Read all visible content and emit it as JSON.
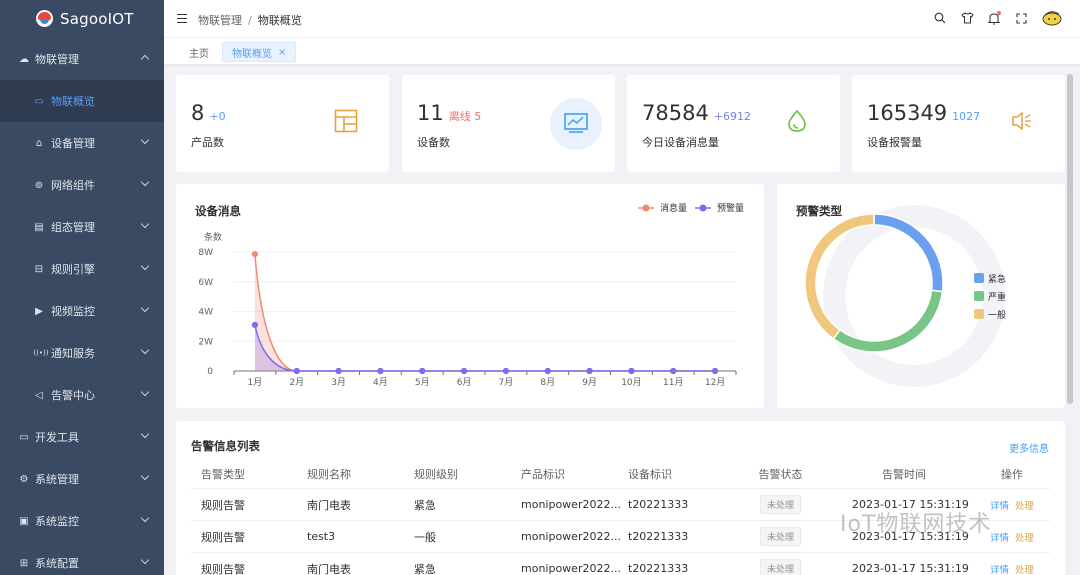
{
  "app": {
    "title": "SagooIOT"
  },
  "sidebar": {
    "items": [
      {
        "label": "物联管理",
        "icon": "cloud-icon",
        "level": "top",
        "expanded": true
      },
      {
        "label": "物联概览",
        "icon": "monitor-icon",
        "level": "sub",
        "active": true
      },
      {
        "label": "设备管理",
        "icon": "devices-icon",
        "level": "sub"
      },
      {
        "label": "网络组件",
        "icon": "network-icon",
        "level": "sub"
      },
      {
        "label": "组态管理",
        "icon": "layout-icon",
        "level": "sub"
      },
      {
        "label": "规则引擎",
        "icon": "rule-icon",
        "level": "sub"
      },
      {
        "label": "视频监控",
        "icon": "video-icon",
        "level": "sub"
      },
      {
        "label": "通知服务",
        "icon": "broadcast-icon",
        "level": "sub"
      },
      {
        "label": "告警中心",
        "icon": "speaker-icon",
        "level": "sub"
      },
      {
        "label": "开发工具",
        "icon": "tools-icon",
        "level": "top"
      },
      {
        "label": "系统管理",
        "icon": "settings-icon",
        "level": "top"
      },
      {
        "label": "系统监控",
        "icon": "monitor-chart-icon",
        "level": "top"
      },
      {
        "label": "系统配置",
        "icon": "config-icon",
        "level": "top"
      }
    ]
  },
  "header": {
    "breadcrumb": [
      "物联管理",
      "物联概览"
    ],
    "sep": "/"
  },
  "tabs": [
    {
      "label": "主页"
    },
    {
      "label": "物联概览",
      "close": "×"
    }
  ],
  "stats": [
    {
      "value": "8",
      "delta": "+0",
      "delta_color": "#5b9cf5",
      "label": "产品数",
      "icon": "layout-icon",
      "icon_color": "#e6a23c"
    },
    {
      "value": "11",
      "delta": "离线 5",
      "delta_color": "#f56c6c",
      "label": "设备数",
      "icon": "monitor-chart-icon",
      "icon_color": "#409eff"
    },
    {
      "value": "78584",
      "delta": "+6912",
      "delta_color": "#7b7fe6",
      "label": "今日设备消息量",
      "icon": "droplet-icon",
      "icon_color": "#67c23a"
    },
    {
      "value": "165349",
      "delta": "1027",
      "delta_color": "#5b9cf5",
      "label": "设备报警量",
      "icon": "speaker-icon",
      "icon_color": "#e6a23c"
    }
  ],
  "line_chart": {
    "title": "设备消息",
    "y_unit": "条数",
    "legend": [
      "消息量",
      "预警量"
    ]
  },
  "pie_chart": {
    "title": "预警类型"
  },
  "chart_data": [
    {
      "type": "line",
      "title": "设备消息",
      "ylabel": "条数",
      "categories": [
        "1月",
        "2月",
        "3月",
        "4月",
        "5月",
        "6月",
        "7月",
        "8月",
        "9月",
        "10月",
        "11月",
        "12月"
      ],
      "y_ticks": [
        "0",
        "2W",
        "4W",
        "6W",
        "8W"
      ],
      "ylim": [
        0,
        80000
      ],
      "series": [
        {
          "name": "消息量",
          "color": "#ee8b76",
          "values": [
            78584,
            0,
            0,
            0,
            0,
            0,
            0,
            0,
            0,
            0,
            0,
            0
          ]
        },
        {
          "name": "预警量",
          "color": "#7b6cf0",
          "values": [
            31000,
            0,
            0,
            0,
            0,
            0,
            0,
            0,
            0,
            0,
            0,
            0
          ]
        }
      ],
      "legend_position": "top-right",
      "grid": true
    },
    {
      "type": "pie",
      "title": "预警类型",
      "legend_position": "right",
      "slices": [
        {
          "name": "紧急",
          "value": 27,
          "color": "#6b9ff0"
        },
        {
          "name": "严重",
          "value": 33,
          "color": "#79c487"
        },
        {
          "name": "一般",
          "value": 40,
          "color": "#f0c77c"
        }
      ]
    }
  ],
  "alarm_table": {
    "title": "告警信息列表",
    "more": "更多信息",
    "columns": [
      "告警类型",
      "规则名称",
      "规则级别",
      "产品标识",
      "设备标识",
      "告警状态",
      "告警时间",
      "操作"
    ],
    "rows": [
      {
        "type": "规则告警",
        "rule": "南门电表",
        "level": "紧急",
        "product": "monipower2022...",
        "device": "t20221333",
        "status": "未处理",
        "time": "2023-01-17 15:31:19",
        "detail": "详情",
        "handle": "处理"
      },
      {
        "type": "规则告警",
        "rule": "test3",
        "level": "一般",
        "product": "monipower2022...",
        "device": "t20221333",
        "status": "未处理",
        "time": "2023-01-17 15:31:19",
        "detail": "详情",
        "handle": "处理"
      },
      {
        "type": "规则告警",
        "rule": "南门电表",
        "level": "紧急",
        "product": "monipower2022...",
        "device": "t20221333",
        "status": "未处理",
        "time": "2023-01-17 15:31:19",
        "detail": "详情",
        "handle": "处理"
      }
    ]
  },
  "watermark": "IoT物联网技术"
}
